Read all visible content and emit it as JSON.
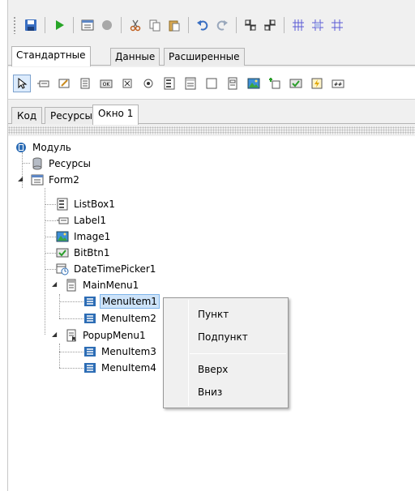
{
  "palette_tabs": [
    "Стандартные",
    "Данные",
    "Расширенные"
  ],
  "editor_tabs": [
    "Код",
    "Ресурсы",
    "Окно 1"
  ],
  "tree": {
    "root": "Модуль",
    "resources": "Ресурсы",
    "form": "Form2",
    "listbox": "ListBox1",
    "label": "Label1",
    "image": "Image1",
    "bitbtn": "BitBtn1",
    "datetimepicker": "DateTimePicker1",
    "mainmenu": "MainMenu1",
    "menuitem1": "MenuItem1",
    "menuitem2": "MenuItem2",
    "popupmenu": "PopupMenu1",
    "menuitem3": "MenuItem3",
    "menuitem4": "MenuItem4"
  },
  "context_menu": {
    "item1": "Пункт",
    "item2": "Подпункт",
    "item3": "Вверх",
    "item4": "Вниз"
  }
}
